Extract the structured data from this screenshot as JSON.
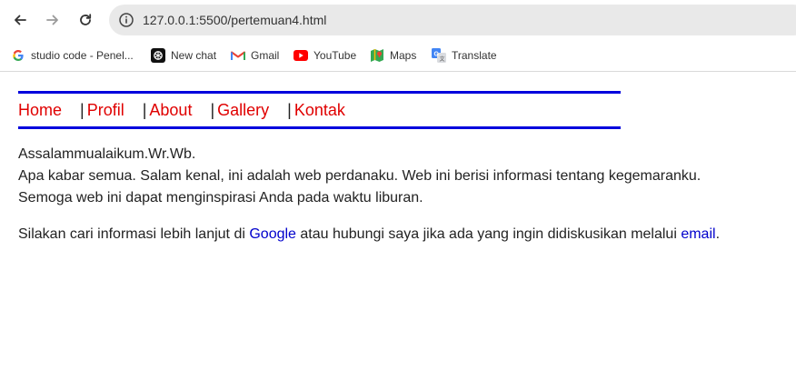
{
  "browser": {
    "url": "127.0.0.1:5500/pertemuan4.html",
    "bookmarks": [
      {
        "label": "studio code - Penel...",
        "icon": "google-icon"
      },
      {
        "label": "New chat",
        "icon": "openai-icon"
      },
      {
        "label": "Gmail",
        "icon": "gmail-icon"
      },
      {
        "label": "YouTube",
        "icon": "youtube-icon"
      },
      {
        "label": "Maps",
        "icon": "maps-icon"
      },
      {
        "label": "Translate",
        "icon": "translate-icon"
      }
    ]
  },
  "page": {
    "menu": {
      "separator": "|",
      "items": [
        "Home",
        "Profil",
        "About",
        "Gallery",
        "Kontak"
      ]
    },
    "greeting": "Assalammualaikum.Wr.Wb.",
    "intro_line1": "Apa kabar semua. Salam kenal, ini adalah web perdanaku. Web ini berisi informasi tentang kegemaranku.",
    "intro_line2": "Semoga web ini dapat menginspirasi Anda pada waktu liburan.",
    "info_prefix": "Silakan cari informasi lebih lanjut di ",
    "info_link_google": "Google",
    "info_middle": " atau hubungi saya jika ada yang ingin didiskusikan melalui ",
    "info_link_email": "email",
    "info_suffix": "."
  },
  "colors": {
    "rule": "#0000dd",
    "menu_link": "#e00000",
    "body_link": "#0000cc"
  }
}
